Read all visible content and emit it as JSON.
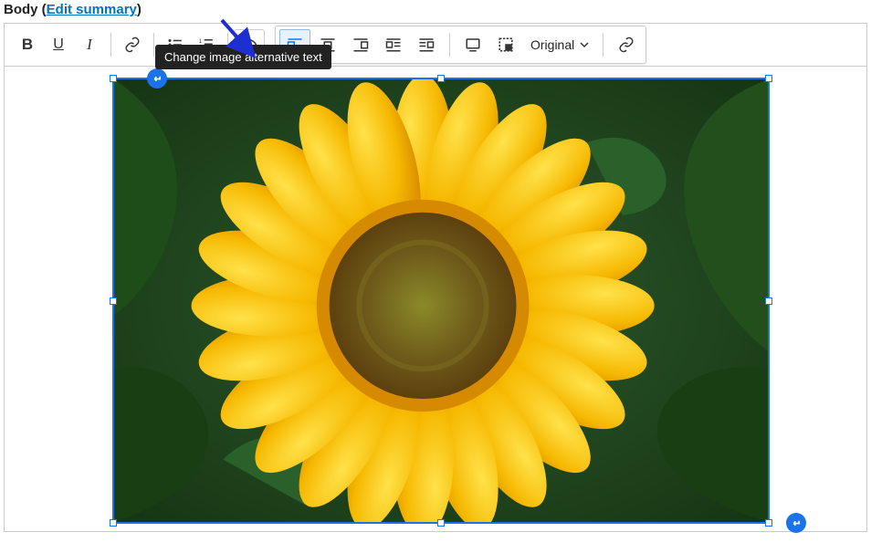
{
  "header": {
    "label": "Body",
    "edit_summary": "Edit summary"
  },
  "toolbar": {
    "bold_label": "B",
    "underline_label": "U",
    "italic_label": "I"
  },
  "float_toolbar": {
    "size_label": "Original"
  },
  "tooltip": {
    "alt_text": "Change image alternative text"
  },
  "image": {
    "alt": "Sunflower in a green leaf field"
  }
}
